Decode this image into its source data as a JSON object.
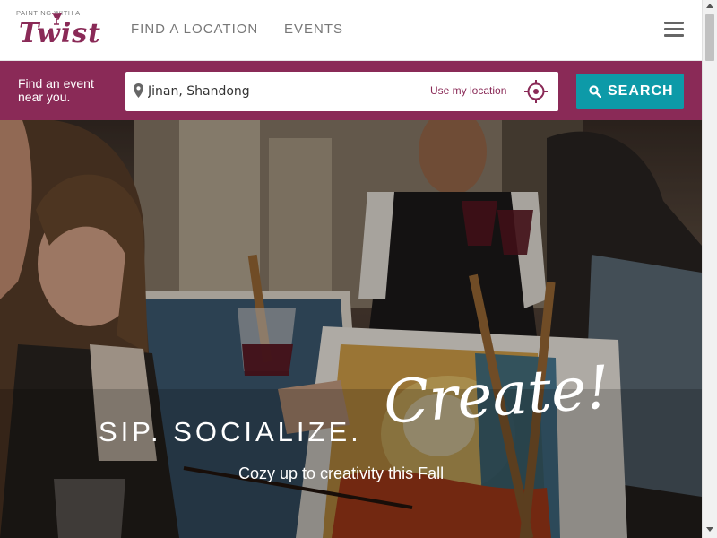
{
  "header": {
    "logo_top": "PAINTING WITH A",
    "logo_main": "Twist",
    "nav": [
      {
        "label": "FIND A LOCATION"
      },
      {
        "label": "EVENTS"
      }
    ]
  },
  "search": {
    "prompt": "Find an event near you.",
    "location_value": "Jinan, Shandong",
    "use_location": "Use my location",
    "button_label": "SEARCH"
  },
  "hero": {
    "tagline": "SIP. SOCIALIZE.",
    "create": "Create!",
    "subtitle": "Cozy up to creativity this Fall"
  },
  "colors": {
    "brand": "#8a2a57",
    "accent": "#0d9aa8"
  },
  "icons": [
    "wine-glass-icon",
    "hamburger-menu-icon",
    "map-pin-icon",
    "crosshair-icon",
    "search-icon"
  ]
}
